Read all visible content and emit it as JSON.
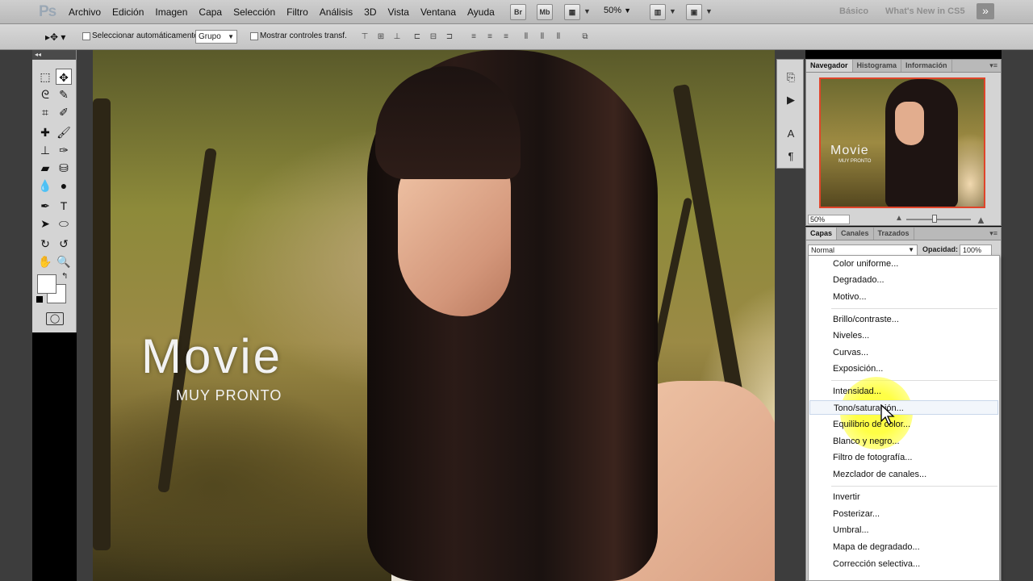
{
  "app": {
    "logo": "Ps"
  },
  "menu": [
    "Archivo",
    "Edición",
    "Imagen",
    "Capa",
    "Selección",
    "Filtro",
    "Análisis",
    "3D",
    "Vista",
    "Ventana",
    "Ayuda"
  ],
  "menubar_buttons": {
    "bridge": "Br",
    "minibridge": "Mb",
    "zoom": "50%"
  },
  "workspaces": {
    "basic": "Básico",
    "whats_new": "What's New in CS5"
  },
  "options": {
    "auto_select_label": "Seleccionar automáticamente:",
    "auto_select_value": "Grupo",
    "show_transform_label": "Mostrar controles transf."
  },
  "toolbox": {
    "tools": [
      "marquee",
      "move",
      "lasso",
      "quick-selection",
      "crop",
      "eyedropper",
      "spot-healing",
      "brush",
      "clone-stamp",
      "history-brush",
      "eraser",
      "paint-bucket",
      "blur",
      "dodge",
      "pen",
      "type",
      "path-selection",
      "shape",
      "3d-rotate",
      "3d-orbit",
      "hand",
      "zoom"
    ],
    "active": "move"
  },
  "canvas": {
    "title": "Movie",
    "subtitle": "MUY PRONTO"
  },
  "navigator_panel": {
    "tabs": [
      "Navegador",
      "Histograma",
      "Información"
    ],
    "active_tab": "Navegador",
    "zoom": "50%",
    "thumb_title": "Movie",
    "thumb_subtitle": "MUY PRONTO"
  },
  "layers_panel": {
    "tabs": [
      "Capas",
      "Canales",
      "Trazados"
    ],
    "active_tab": "Capas",
    "blend_mode": "Normal",
    "opacity_label": "Opacidad:",
    "opacity_value": "100%"
  },
  "adjustment_menu": {
    "groups": [
      [
        "Color uniforme...",
        "Degradado...",
        "Motivo..."
      ],
      [
        "Brillo/contraste...",
        "Niveles...",
        "Curvas...",
        "Exposición..."
      ],
      [
        "Intensidad...",
        "Tono/saturación...",
        "Equilibrio de color...",
        "Blanco y negro...",
        "Filtro de fotografía...",
        "Mezclador de canales..."
      ],
      [
        "Invertir",
        "Posterizar...",
        "Umbral...",
        "Mapa de degradado...",
        "Corrección selectiva..."
      ]
    ],
    "highlighted": "Tono/saturación..."
  },
  "colors": {
    "accent_red": "#e0442a",
    "highlight_yellow": "#ffff3c"
  }
}
